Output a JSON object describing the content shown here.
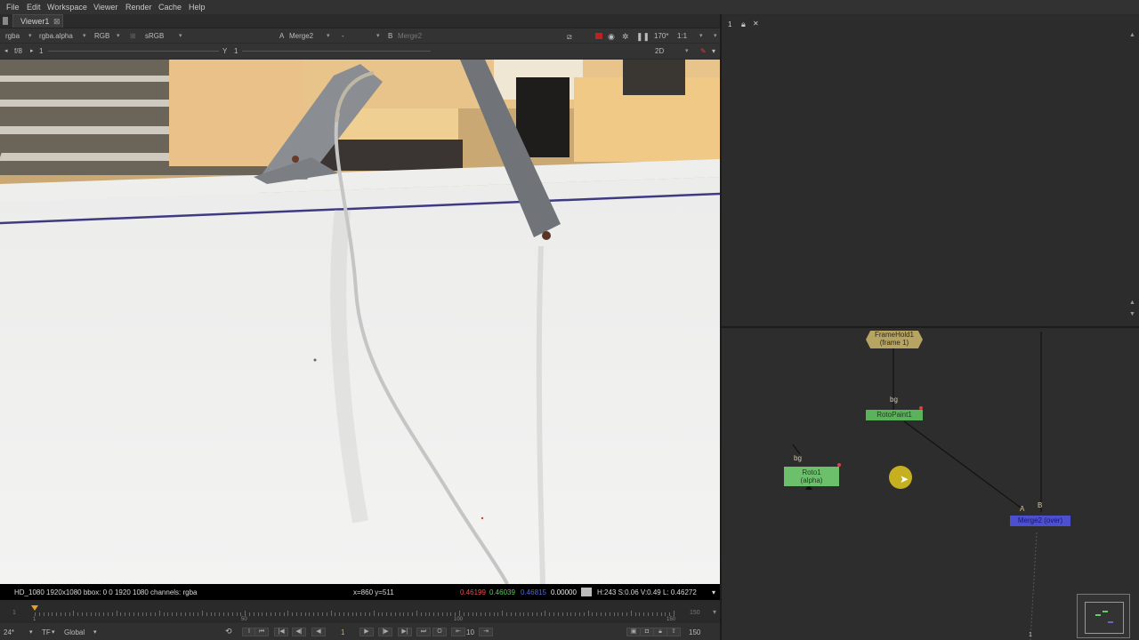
{
  "menu": [
    "File",
    "Edit",
    "Workspace",
    "Viewer",
    "Render",
    "Cache",
    "Help"
  ],
  "viewer_tab": {
    "label": "Viewer1",
    "close": "⊠"
  },
  "viewer_toolbar": {
    "channels": "rgba",
    "alpha_channel": "rgba.alpha",
    "display": "RGB",
    "lut": "sRGB",
    "input_a_letter": "A",
    "input_a": "Merge2",
    "input_mid": "-",
    "input_b_letter": "B",
    "input_b": "Merge2",
    "zoom": "170*",
    "ratio": "1:1"
  },
  "viewer_toolbar2": {
    "fstop": "f/8",
    "gain": "1",
    "gamma_label": "Y",
    "gamma": "1",
    "view_mode": "2D"
  },
  "info_bar": {
    "format": "HD_1080 1920x1080  bbox: 0 0 1920 1080 channels: rgba",
    "coords": "x=860 y=511",
    "r": "0.46199",
    "g": "0.46039",
    "b": "0.46815",
    "a": "0.00000",
    "hsvl": "H:243 S:0.06 V:0.49  L: 0.46272"
  },
  "timeline": {
    "start": "1",
    "ticks": [
      "1",
      "50",
      "100",
      "150"
    ],
    "end": "150",
    "current_frame": 1,
    "last_frame": 150
  },
  "bottom_bar": {
    "fps": "24*",
    "tf": "TF",
    "range_mode": "Global",
    "frame": "1",
    "increment": "10",
    "end_frame": "150"
  },
  "properties_panel": {
    "count": "1",
    "close": "✕"
  },
  "node_graph": {
    "nodes": {
      "framehold": {
        "line1": "FrameHold1",
        "line2": "(frame 1)",
        "color": "#b7a462"
      },
      "rotopaint": {
        "label": "RotoPaint1",
        "input": "bg",
        "color": "#5ab35a"
      },
      "roto": {
        "line1": "Roto1",
        "line2": "(alpha)",
        "input": "bg",
        "color": "#6cc06c"
      },
      "merge": {
        "label": "Merge2 (over)",
        "input_a": "A",
        "input_b": "B",
        "color": "#4b4fd0"
      }
    },
    "minimap_badge": "1"
  },
  "colors": {
    "accent_red": "#e04040",
    "cursor_highlight": "#e2c81e"
  }
}
